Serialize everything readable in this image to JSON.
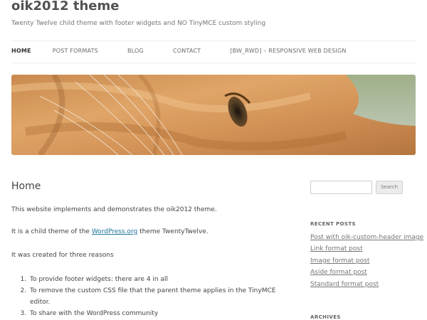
{
  "site": {
    "title": "oik2012 theme",
    "description": "Twenty Twelve child theme with footer widgets and NO TinyMCE custom styling"
  },
  "nav": {
    "items": [
      {
        "label": "HOME",
        "active": true
      },
      {
        "label": "POST FORMATS"
      },
      {
        "label": "BLOG"
      },
      {
        "label": "CONTACT"
      },
      {
        "label": "[BW_RWD] – RESPONSIVE WEB DESIGN"
      }
    ]
  },
  "header_image": {
    "alt": "close-up of an orange tabby cat's eye"
  },
  "content": {
    "title": "Home",
    "p1": "This website implements and demonstrates the oik2012 theme.",
    "p2_before": "It is a child theme of the ",
    "p2_link": "WordPress.org",
    "p2_after": " theme TwentyTwelve.",
    "p3": "It was created for three reasons",
    "reasons": [
      "To provide footer widgets: there are 4 in all",
      "To remove the custom CSS file that the parent theme applies in the TinyMCE editor.",
      "To share with the WordPress community"
    ]
  },
  "sidebar": {
    "search_placeholder": "",
    "search_button": "Search",
    "recent_posts_title": "RECENT POSTS",
    "recent_posts": [
      "Post with oik-custom-header image",
      "Link format post",
      "Image format post",
      "Aside format post",
      "Standard format post"
    ],
    "archives_title": "ARCHIVES"
  },
  "colors": {
    "link": "#21759b",
    "text": "#444444"
  }
}
